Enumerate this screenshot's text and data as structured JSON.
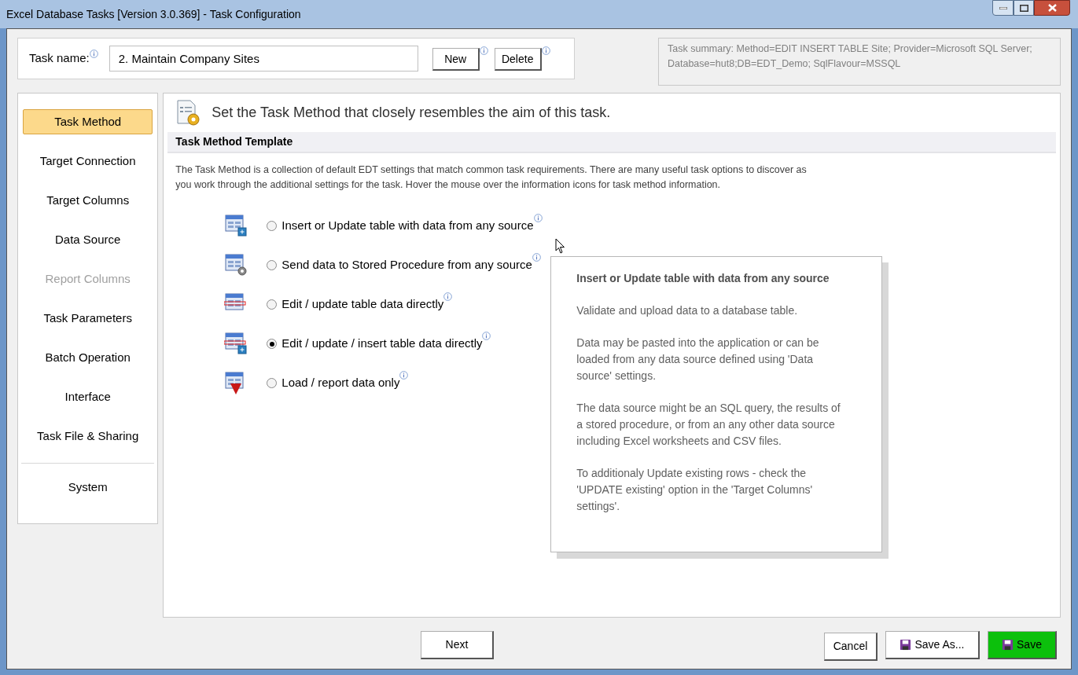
{
  "window": {
    "title": "Excel Database Tasks [Version 3.0.369] - Task Configuration"
  },
  "task_name": {
    "label": "Task name:",
    "value": "2. Maintain Company Sites"
  },
  "task_buttons": [
    "New",
    "Delete"
  ],
  "summary": "Task summary: Method=EDIT INSERT TABLE Site; Provider=Microsoft SQL Server; Database=hut8;DB=EDT_Demo; SqlFlavour=MSSQL",
  "sidebar": {
    "items": [
      {
        "label": "Task Method",
        "selected": true,
        "disabled": false
      },
      {
        "label": "Target Connection",
        "selected": false,
        "disabled": false
      },
      {
        "label": "Target Columns",
        "selected": false,
        "disabled": false
      },
      {
        "label": "Data Source",
        "selected": false,
        "disabled": false
      },
      {
        "label": "Report Columns",
        "selected": false,
        "disabled": true
      },
      {
        "label": "Task Parameters",
        "selected": false,
        "disabled": false
      },
      {
        "label": "Batch Operation",
        "selected": false,
        "disabled": false
      },
      {
        "label": "Interface",
        "selected": false,
        "disabled": false
      },
      {
        "label": "Task File & Sharing",
        "selected": false,
        "disabled": false
      }
    ],
    "footer_items": [
      {
        "label": "System",
        "selected": false,
        "disabled": false
      }
    ]
  },
  "main": {
    "heading": "Set the Task Method that closely resembles the aim of this task.",
    "section_title": "Task Method Template",
    "description": "The Task Method is a collection of default EDT settings that match common task requirements. There are many useful task options to discover as you work through the additional settings for the task. Hover the mouse over the information icons for task method information.",
    "options": [
      {
        "kind": "insert",
        "label": "Insert or Update table with data from any source",
        "selected": false
      },
      {
        "kind": "procedure",
        "label": "Send data to Stored Procedure from any source",
        "selected": false
      },
      {
        "kind": "edit",
        "label": "Edit / update table data directly",
        "selected": false
      },
      {
        "kind": "edit_insert",
        "label": "Edit / update / insert table data directly",
        "selected": true
      },
      {
        "kind": "load",
        "label": "Load / report data only",
        "selected": false
      }
    ]
  },
  "tooltip": {
    "title": "Insert or Update table with data from any source",
    "paragraphs": [
      "Validate and upload data to a database table.",
      "Data may be pasted into the application or can be loaded from any data source defined using 'Data source' settings.",
      "The data source might be an SQL query, the results of a stored procedure, or from an any other data source including Excel worksheets and CSV files.",
      "To additionaly Update existing rows - check the 'UPDATE existing' option in the 'Target Columns' settings'."
    ]
  },
  "footer": {
    "next": "Next",
    "cancel": "Cancel",
    "save_as": "Save As...",
    "save": "Save"
  }
}
